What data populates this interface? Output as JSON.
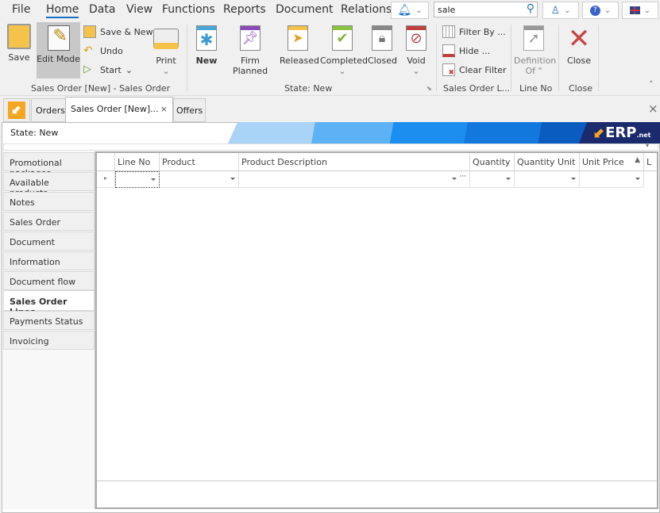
{
  "menu": [
    "File",
    "Home",
    "Data",
    "View",
    "Functions",
    "Reports",
    "Document",
    "Relations"
  ],
  "active_menu": "Home",
  "search": {
    "value": "sale"
  },
  "icons": {
    "bell": "bell-icon",
    "search": "magnifier-icon",
    "user": "user-icon",
    "help": "help-icon",
    "flag": "uk-flag-icon"
  },
  "ribbon": {
    "save": "Save",
    "edit_mode": "Edit Mode",
    "save_new": "Save & New",
    "undo": "Undo",
    "start": "Start",
    "print": "Print",
    "group1": "Sales Order [New] - Sales Order",
    "states": [
      "New",
      "Firm Planned",
      "Released",
      "Completed",
      "Closed",
      "Void"
    ],
    "group2": "State: New",
    "filter_by": "Filter By ...",
    "hide": "Hide ...",
    "clear_filter": "Clear Filter",
    "group3": "Sales Order L...",
    "definition_of": "Definition Of \"",
    "group4": "Line No",
    "close": "Close",
    "group5": "Close"
  },
  "tabs": [
    "Orders",
    "Sales Order [New]...",
    "Offers"
  ],
  "state_label": "State: New",
  "logo": "ERP.net",
  "colors": {
    "accent": "#1a6fc4",
    "logo_orange": "#f5a623",
    "banner_dark": "#1a2a6c"
  },
  "side_tabs": [
    "Promotional packages",
    "Available products",
    "Notes",
    "Sales Order",
    "Document",
    "Information",
    "Document flow",
    "Sales Order Lines",
    "Payments Status",
    "Invoicing"
  ],
  "selected_side_tab": "Sales Order Lines",
  "grid": {
    "columns": [
      "Line No",
      "Product",
      "Product Description",
      "Quantity",
      "Quantity Unit",
      "Unit Price",
      "L"
    ]
  }
}
